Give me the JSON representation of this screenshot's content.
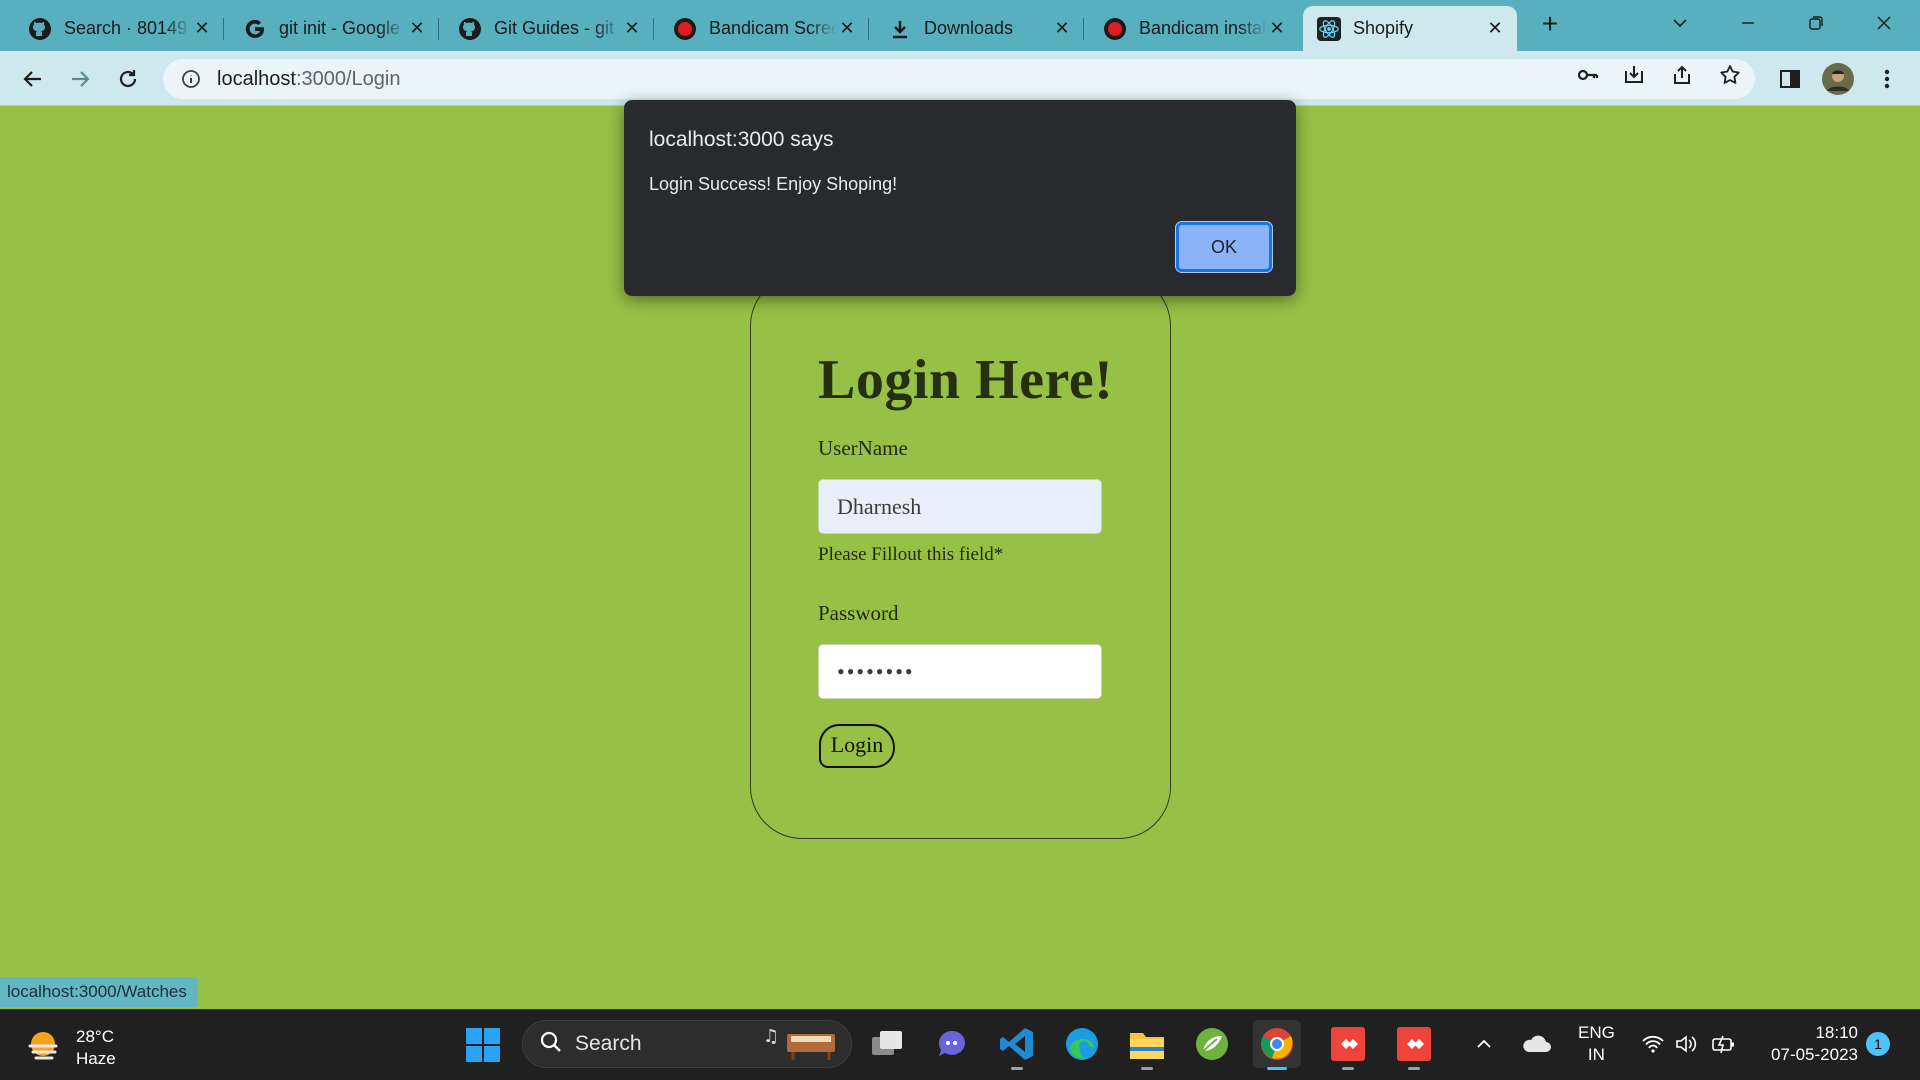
{
  "browser": {
    "tabs": [
      {
        "title": "Search · 80149",
        "icon": "github-icon"
      },
      {
        "title": "git init - Google",
        "icon": "google-icon"
      },
      {
        "title": "Git Guides - git",
        "icon": "github-icon"
      },
      {
        "title": "Bandicam Screen",
        "icon": "bandicam-icon"
      },
      {
        "title": "Downloads",
        "icon": "download-icon"
      },
      {
        "title": "Bandicam install",
        "icon": "bandicam-icon"
      },
      {
        "title": "Shopify",
        "icon": "react-icon",
        "active": true
      }
    ],
    "address": {
      "host": "localhost",
      "path": ":3000/Login"
    },
    "status_url": "localhost:3000/Watches"
  },
  "page": {
    "title": "Login Here!",
    "username_label": "UserName",
    "username_value": "Dharnesh",
    "username_hint": "Please Fillout this field*",
    "password_label": "Password",
    "password_value": "••••••••",
    "login_button": "Login",
    "background_color": "#97c146"
  },
  "dialog": {
    "title": "localhost:3000 says",
    "message": "Login Success!  Enjoy Shoping!",
    "ok_label": "OK"
  },
  "taskbar": {
    "weather_temp": "28°C",
    "weather_desc": "Haze",
    "search_label": "Search",
    "lang_top": "ENG",
    "lang_bottom": "IN",
    "time": "18:10",
    "date": "07-05-2023",
    "notification_count": "1"
  }
}
